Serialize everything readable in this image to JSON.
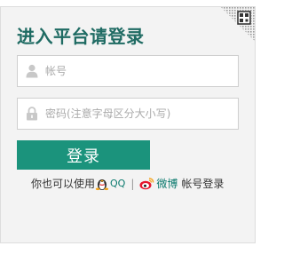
{
  "login": {
    "title": "进入平台请登录",
    "username_placeholder": "帐号",
    "password_placeholder": "密码(注意字母区分大小写)",
    "submit_label": "登录",
    "alt_prefix": "你也可以使用",
    "qq_label": "QQ",
    "separator": "|",
    "weibo_label": "微博",
    "alt_suffix": "帐号登录"
  },
  "icons": {
    "qr_corner": "qr-code-icon",
    "username": "user-icon",
    "password": "lock-icon",
    "qq": "qq-penguin-icon",
    "weibo": "weibo-icon"
  },
  "colors": {
    "title": "#1f6b63",
    "button": "#1b937c",
    "link": "#0b7a6e"
  }
}
